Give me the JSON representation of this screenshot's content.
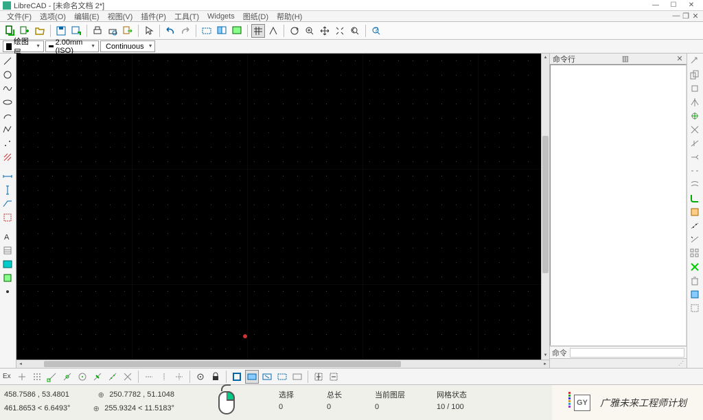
{
  "app_title": "LibreCAD - [未命名文档 2*]",
  "menu": [
    "文件(F)",
    "选项(O)",
    "编辑(E)",
    "视图(V)",
    "插件(P)",
    "工具(T)",
    "Widgets",
    "图纸(D)",
    "帮助(H)"
  ],
  "layer": {
    "name": "绘图层",
    "linewidth": "2.00mm (ISO)",
    "linetype": "Continuous"
  },
  "command_panel": {
    "title": "命令行",
    "prompt": "命令"
  },
  "status": {
    "abs_coord": "458.7586 , 53.4801",
    "rel_coord": "461.8653 < 6.6493°",
    "abs2": "250.7782 , 51.1048",
    "rel2": "255.9324 < 11.5183°",
    "labels": {
      "select": "选择",
      "length": "总长",
      "layer": "当前图层",
      "grid": "网格状态"
    },
    "values": {
      "select": "0",
      "length": "0",
      "layer": "0",
      "grid": "10 / 100"
    }
  },
  "watermark": {
    "gy": "GY",
    "text": "广雅未来工程师计划"
  },
  "snap_label": "Ex"
}
